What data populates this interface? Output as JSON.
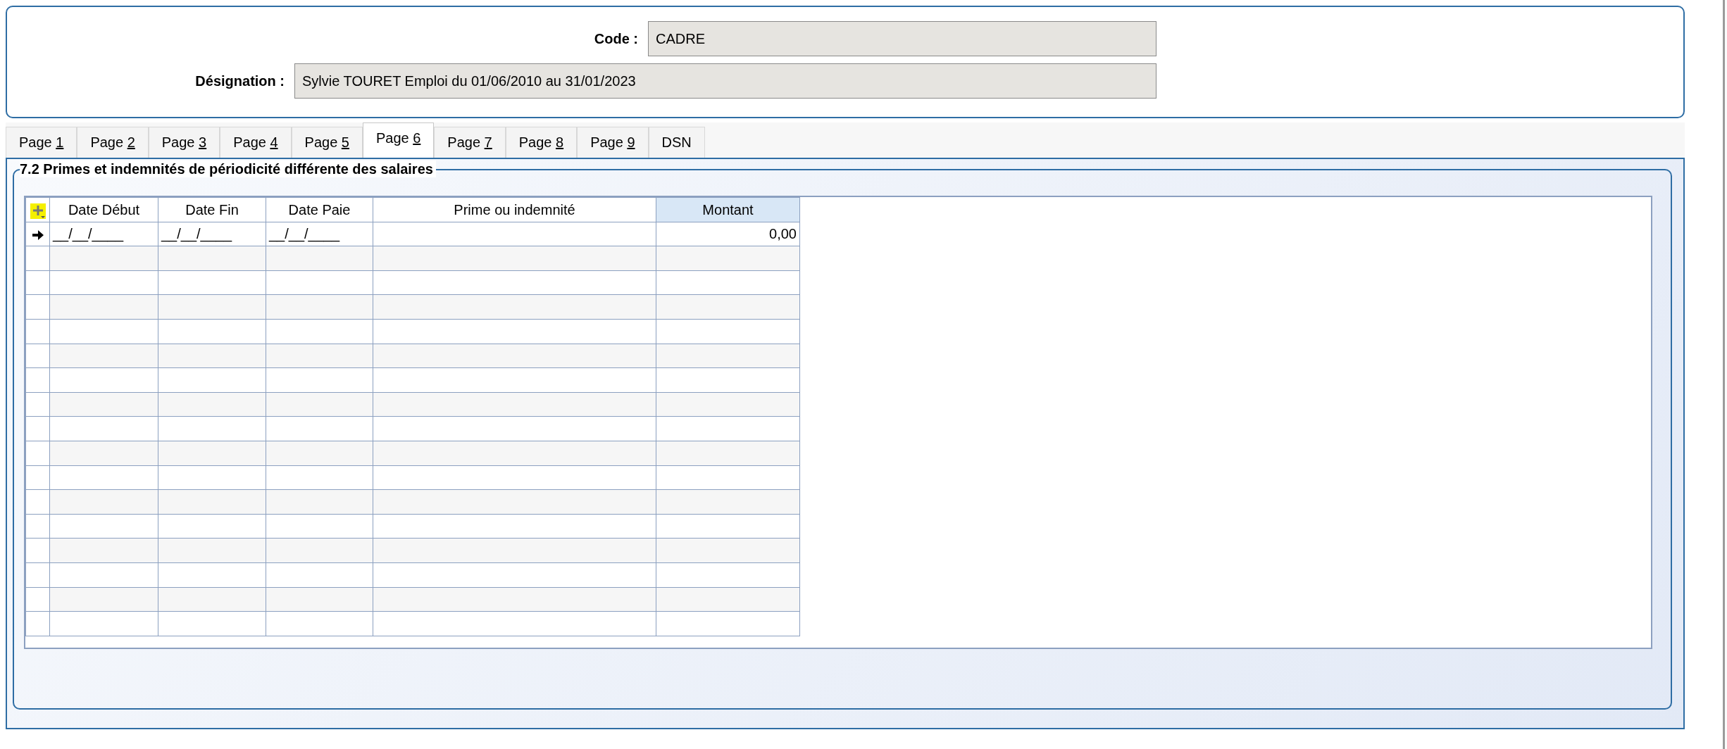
{
  "header": {
    "fields": [
      {
        "label": "Code :",
        "value": "CADRE"
      },
      {
        "label": "Désignation :",
        "value": "Sylvie TOURET Emploi du 01/06/2010 au 31/01/2023"
      }
    ]
  },
  "tabs": [
    {
      "label": "Page 1",
      "underline_last": true,
      "selected": false
    },
    {
      "label": "Page 2",
      "underline_last": true,
      "selected": false
    },
    {
      "label": "Page 3",
      "underline_last": true,
      "selected": false
    },
    {
      "label": "Page 4",
      "underline_last": true,
      "selected": false
    },
    {
      "label": "Page 5",
      "underline_last": true,
      "selected": false
    },
    {
      "label": "Page 6",
      "underline_last": true,
      "selected": true
    },
    {
      "label": "Page 7",
      "underline_last": true,
      "selected": false
    },
    {
      "label": "Page 8",
      "underline_last": true,
      "selected": false
    },
    {
      "label": "Page 9",
      "underline_last": true,
      "selected": false
    },
    {
      "label": "DSN",
      "underline_last": false,
      "selected": false
    }
  ],
  "group": {
    "title": "7.2 Primes et indemnités de périodicité différente des salaires"
  },
  "table": {
    "columns": [
      {
        "label": "Date Début",
        "kind": "text",
        "selected": false
      },
      {
        "label": "Date Fin",
        "kind": "text",
        "selected": false
      },
      {
        "label": "Date Paie",
        "kind": "text",
        "selected": false
      },
      {
        "label": "Prime ou indemnité",
        "kind": "text",
        "selected": false
      },
      {
        "label": "Montant",
        "kind": "number",
        "selected": true
      }
    ],
    "rows": [
      {
        "current": true,
        "cells": [
          "__/__/____",
          "__/__/____",
          "__/__/____",
          "",
          "0,00"
        ]
      },
      {
        "current": false
      },
      {
        "current": false
      },
      {
        "current": false
      },
      {
        "current": false
      },
      {
        "current": false
      },
      {
        "current": false
      },
      {
        "current": false
      },
      {
        "current": false
      },
      {
        "current": false
      },
      {
        "current": false
      },
      {
        "current": false
      },
      {
        "current": false
      },
      {
        "current": false
      },
      {
        "current": false
      },
      {
        "current": false
      },
      {
        "current": false
      }
    ]
  }
}
